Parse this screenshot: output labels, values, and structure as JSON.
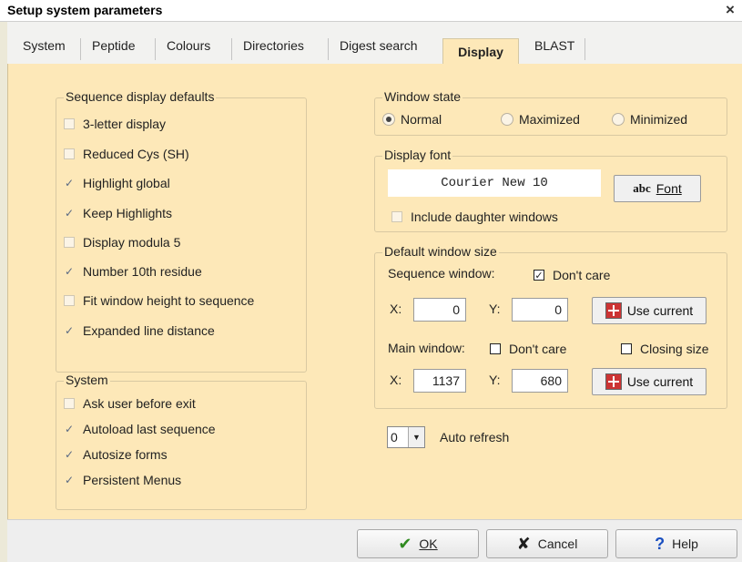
{
  "window": {
    "title": "Setup system parameters",
    "close_glyph": "×"
  },
  "tabs": [
    {
      "label": "System",
      "mnemonic": "S"
    },
    {
      "label": "Peptide",
      "mnemonic": "P"
    },
    {
      "label": "Colours",
      "mnemonic": "C"
    },
    {
      "label": "Directories",
      "mnemonic": "D"
    },
    {
      "label": "Digest search",
      "mnemonic": "g"
    },
    {
      "label": "Display",
      "mnemonic": "y",
      "active": true
    },
    {
      "label": "BLAST",
      "mnemonic": "L"
    }
  ],
  "sequence_defaults": {
    "title": "Sequence display defaults",
    "items": [
      {
        "label": "3-letter display",
        "checked": false
      },
      {
        "label": "Reduced Cys (SH)",
        "checked": false
      },
      {
        "label": "Highlight global",
        "checked": true
      },
      {
        "label": "Keep Highlights",
        "checked": true
      },
      {
        "label": "Display modula 5",
        "checked": false
      },
      {
        "label": "Number 10th residue",
        "checked": true
      },
      {
        "label": "Fit window height to sequence",
        "checked": false
      },
      {
        "label": "Expanded line distance",
        "checked": true
      }
    ]
  },
  "system_group": {
    "title": "System",
    "items": [
      {
        "label": "Ask user before exit",
        "checked": false
      },
      {
        "label": "Autoload last sequence",
        "checked": true
      },
      {
        "label": "Autosize forms",
        "checked": true
      },
      {
        "label": "Persistent Menus",
        "checked": true
      }
    ]
  },
  "window_state": {
    "title": "Window state",
    "options": [
      {
        "label": "Normal",
        "selected": true
      },
      {
        "label": "Maximized",
        "selected": false
      },
      {
        "label": "Minimized",
        "selected": false
      }
    ]
  },
  "display_font": {
    "title": "Display font",
    "current": "Courier New 10",
    "font_button_icon": "abc",
    "font_button_label": "Font",
    "include_daughter": "Include daughter windows"
  },
  "default_size": {
    "title": "Default window size",
    "seq_label": "Sequence window:",
    "dont_care": "Don't care",
    "x_label": "X:",
    "y_label": "Y:",
    "seq_x": "0",
    "seq_y": "0",
    "use_current": "Use current",
    "main_label": "Main window:",
    "main_dont_care": "Don't care",
    "closing_size": "Closing size",
    "main_x": "1137",
    "main_y": "680"
  },
  "auto_refresh": {
    "value": "0",
    "label": "Auto refresh"
  },
  "buttons": {
    "ok": "OK",
    "cancel": "Cancel",
    "help": "Help"
  },
  "icons": {
    "ok": "checkmark-icon",
    "cancel": "cross-icon",
    "help": "question-icon"
  },
  "colors": {
    "panel": "#fde8b8",
    "ok_icon": "#2f8a1f",
    "cancel_icon": "#1e1e1e",
    "help_icon": "#1a4fc0"
  }
}
